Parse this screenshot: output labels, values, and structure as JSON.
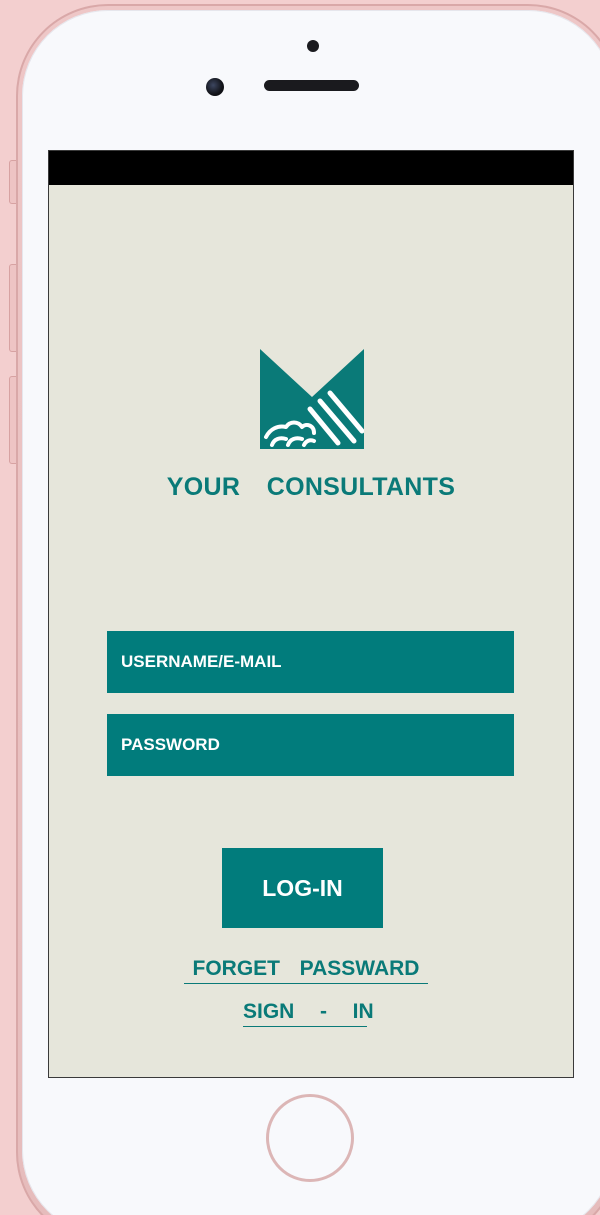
{
  "app": {
    "brand_name": "YOUR  CONSULTANTS",
    "logo_icon": "handshake-m-logo-icon"
  },
  "login_form": {
    "username_placeholder": "USERNAME/E-MAIL",
    "password_placeholder": "PASSWORD",
    "login_label": "LOG-IN",
    "forget_label": "FORGET  PASSWARD",
    "signin_label": "SIGN  -  IN"
  },
  "colors": {
    "accent": "#017c7c",
    "screen_background": "#e6e6db",
    "phone_body": "#eec7c7"
  }
}
